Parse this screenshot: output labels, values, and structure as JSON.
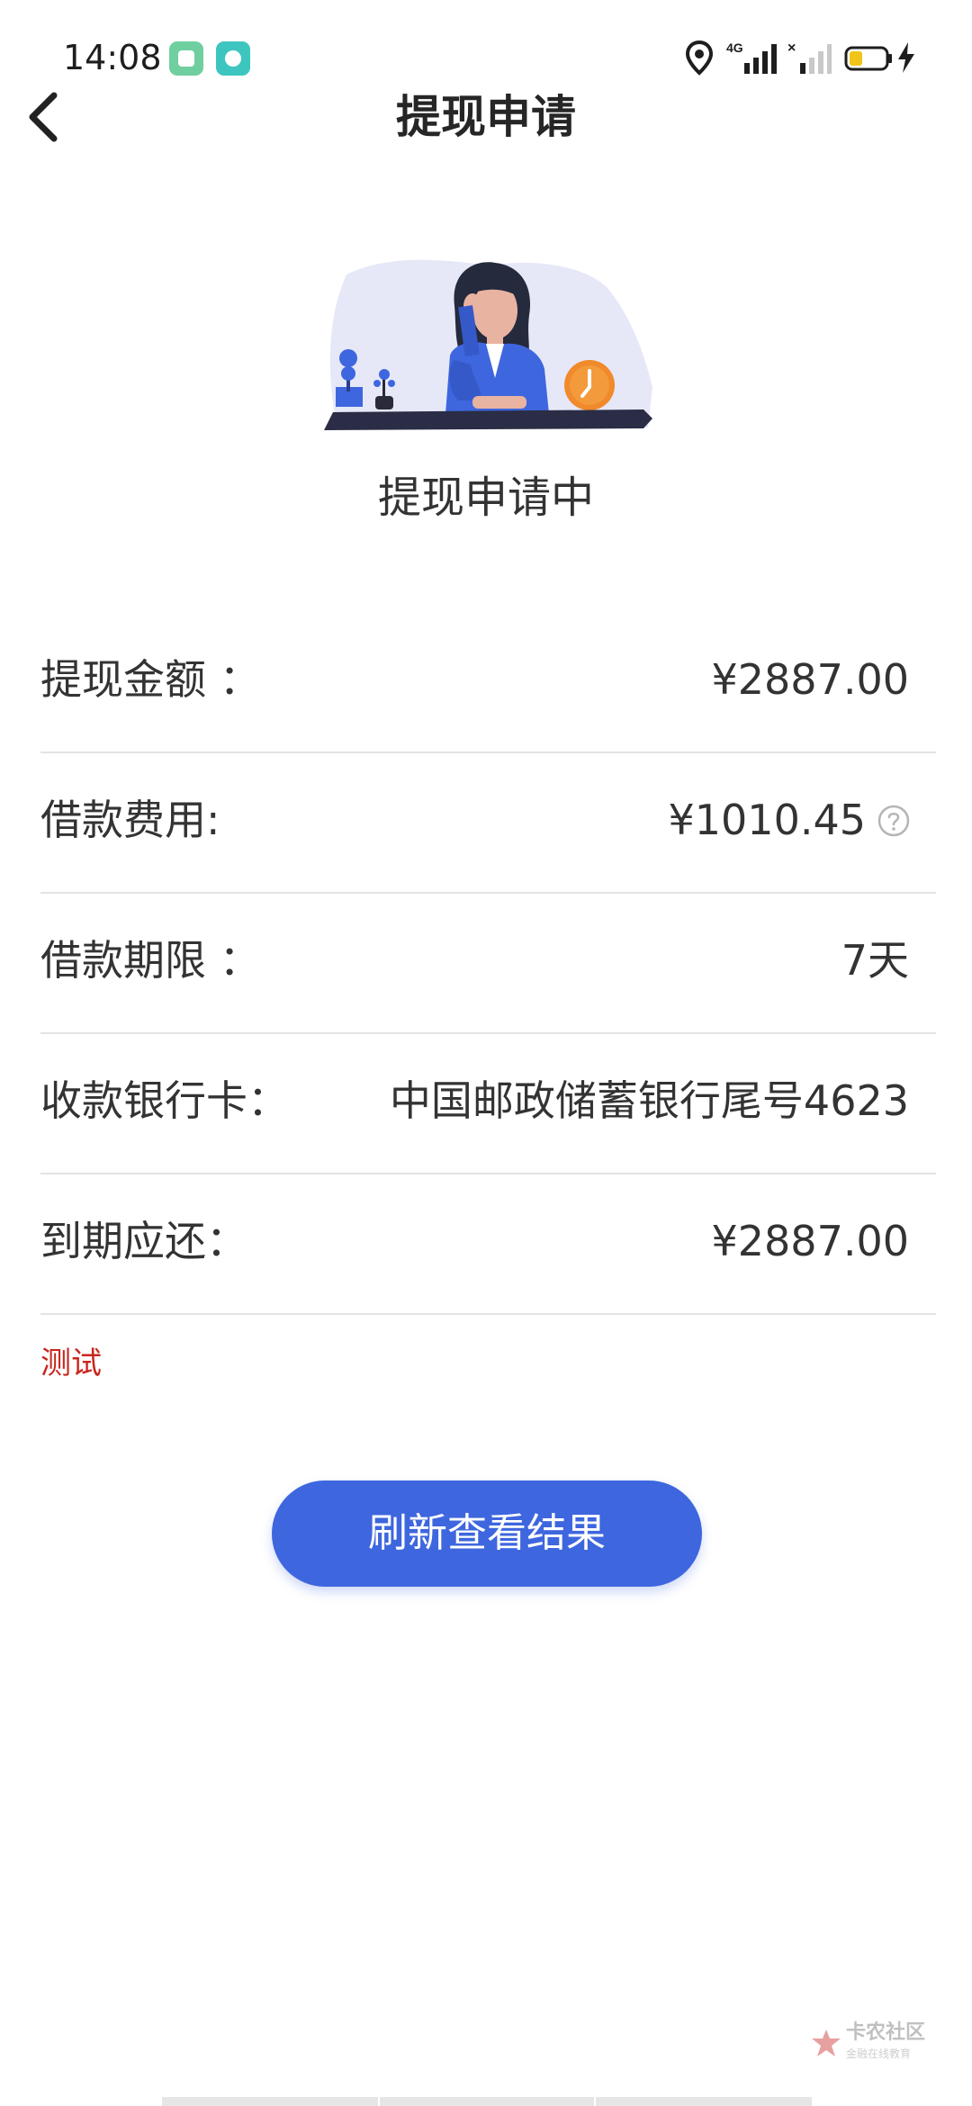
{
  "status_bar": {
    "time": "14:08",
    "icons": [
      "app-icon-green",
      "app-icon-teal",
      "location-icon",
      "signal-4g-icon",
      "no-signal-icon",
      "battery-low-icon",
      "charging-icon"
    ],
    "network": "4G"
  },
  "header": {
    "back_icon": "chevron-left-icon",
    "title": "提现申请"
  },
  "status": {
    "illustration": "woman-waiting-clock-illustration",
    "text": "提现申请中"
  },
  "details": [
    {
      "label": "提现金额 ：",
      "value": "¥2887.00"
    },
    {
      "label": "借款费用:",
      "value": "¥1010.45",
      "help_icon": "question-circle-icon"
    },
    {
      "label": "借款期限 ：",
      "value": "7天"
    },
    {
      "label": "收款银行卡：",
      "value": "中国邮政储蓄银行尾号4623"
    },
    {
      "label": "到期应还：",
      "value": "¥2887.00"
    }
  ],
  "note": "测试",
  "refresh_button": "刷新查看结果",
  "watermark": {
    "text": "卡农社区",
    "sub": "金融在线教育"
  },
  "colors": {
    "accent": "#3e66de",
    "note_red": "#c8261d",
    "divider": "#e3e3e3"
  }
}
